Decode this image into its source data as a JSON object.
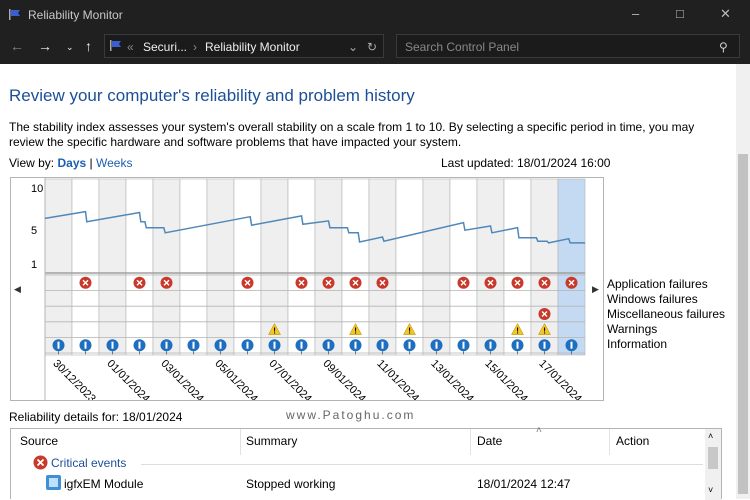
{
  "window": {
    "title": "Reliability Monitor"
  },
  "nav": {
    "breadcrumb": [
      "Securi...",
      "Reliability Monitor"
    ],
    "search_placeholder": "Search Control Panel"
  },
  "page": {
    "heading": "Review your computer's reliability and problem history",
    "description": "The stability index assesses your system's overall stability on a scale from 1 to 10. By selecting a specific period in time, you may review the specific hardware and software problems that have impacted your system.",
    "view_by_label": "View by:",
    "view_days": "Days",
    "view_sep": "|",
    "view_weeks": "Weeks",
    "last_updated": "Last updated: 18/01/2024 16:00"
  },
  "chart_data": {
    "type": "line",
    "title": "Stability index",
    "y_ticks": [
      "10",
      "5",
      "1"
    ],
    "ylim": [
      1,
      10
    ],
    "days": 20,
    "selected_day": 19,
    "date_labels": [
      "30/12/2023",
      "01/01/2024",
      "03/01/2024",
      "05/01/2024",
      "07/01/2024",
      "09/01/2024",
      "11/01/2024",
      "13/01/2024",
      "15/01/2024",
      "17/01/2024"
    ],
    "stability_points": [
      [
        0,
        6.4
      ],
      [
        1.5,
        7.2
      ],
      [
        1.55,
        6.0
      ],
      [
        3.5,
        7.1
      ],
      [
        3.55,
        6.0
      ],
      [
        3.7,
        6.0
      ],
      [
        3.75,
        5.3
      ],
      [
        4.4,
        5.3
      ],
      [
        4.45,
        4.7
      ],
      [
        7.6,
        6.6
      ],
      [
        7.65,
        5.6
      ],
      [
        9.5,
        6.7
      ],
      [
        9.55,
        5.7
      ],
      [
        10.5,
        6.1
      ],
      [
        10.55,
        5.3
      ],
      [
        11.2,
        5.3
      ],
      [
        11.25,
        4.7
      ],
      [
        11.6,
        4.7
      ],
      [
        11.65,
        3.6
      ],
      [
        12.5,
        4.2
      ],
      [
        12.55,
        3.7
      ],
      [
        15.5,
        5.9
      ],
      [
        15.55,
        5.0
      ],
      [
        16.5,
        5.5
      ],
      [
        16.55,
        4.7
      ],
      [
        17.5,
        5.3
      ],
      [
        17.55,
        4.1
      ],
      [
        18.2,
        4.1
      ],
      [
        18.25,
        3.7
      ],
      [
        18.6,
        3.7
      ],
      [
        18.65,
        3.5
      ],
      [
        19.4,
        4.0
      ],
      [
        19.45,
        3.5
      ],
      [
        20,
        3.5
      ]
    ],
    "rows": [
      "Application failures",
      "Windows failures",
      "Miscellaneous failures",
      "Warnings",
      "Information"
    ],
    "events": {
      "Application failures": [
        1,
        3,
        4,
        7,
        9,
        10,
        11,
        12,
        15,
        16,
        17,
        18,
        19
      ],
      "Windows failures": [],
      "Miscellaneous failures": [
        18
      ],
      "Warnings": [
        8,
        11,
        13,
        17,
        18
      ],
      "Information": [
        0,
        1,
        2,
        3,
        4,
        5,
        6,
        7,
        8,
        9,
        10,
        11,
        12,
        13,
        14,
        15,
        16,
        17,
        18,
        19
      ]
    },
    "colors": {
      "line": "#4f88b8",
      "error": "#c8392b",
      "warning": "#f3c623",
      "info": "#1e6fc0",
      "selected": "#c3daf2"
    }
  },
  "details": {
    "label": "Reliability details for: 18/01/2024",
    "watermark": "www.Patoghu.com",
    "columns": [
      "Source",
      "Summary",
      "Date",
      "Action"
    ],
    "group": "Critical events",
    "rows": [
      {
        "source": "igfxEM Module",
        "summary": "Stopped working",
        "date": "18/01/2024 12:47",
        "action": ""
      }
    ]
  }
}
